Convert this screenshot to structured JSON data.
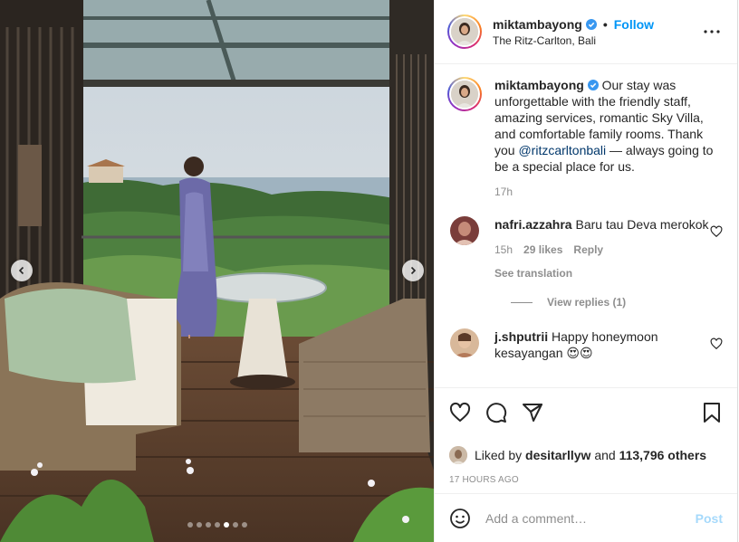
{
  "post": {
    "username": "miktambayong",
    "location": "The Ritz-Carlton, Bali",
    "follow_label": "Follow",
    "separator": "•",
    "caption_text": "Our stay was unforgettable with the friendly staff, amazing services, romantic Sky Villa, and comfortable family rooms. Thank you",
    "caption_mention": "@ritzcarltonbali",
    "caption_tail": "— always going to be a special place for us.",
    "caption_time": "17h",
    "carousel": {
      "total": 7,
      "active_index": 4
    }
  },
  "comments": [
    {
      "username": "nafri.azzahra",
      "text": "Baru tau Deva merokok",
      "time": "15h",
      "likes": "29 likes",
      "reply_label": "Reply",
      "see_translation": "See translation",
      "view_replies": "View replies (1)"
    },
    {
      "username": "j.shputrii",
      "text": "Happy honeymoon kesayangan 😍😍"
    }
  ],
  "likes": {
    "prefix": "Liked by",
    "user": "desitarllyw",
    "connector": "and",
    "others": "113,796 others"
  },
  "timestamp": "17 hours ago",
  "add_comment": {
    "placeholder": "Add a comment…",
    "post_label": "Post"
  },
  "colors": {
    "link": "#0095f6",
    "mention": "#00376b",
    "secondary": "#8e8e8e",
    "verified": "#3897f0"
  },
  "icons": [
    "more-icon",
    "verified-icon",
    "heart-icon",
    "comment-icon",
    "share-icon",
    "bookmark-icon",
    "emoji-icon",
    "chevron-left-icon",
    "chevron-right-icon"
  ]
}
